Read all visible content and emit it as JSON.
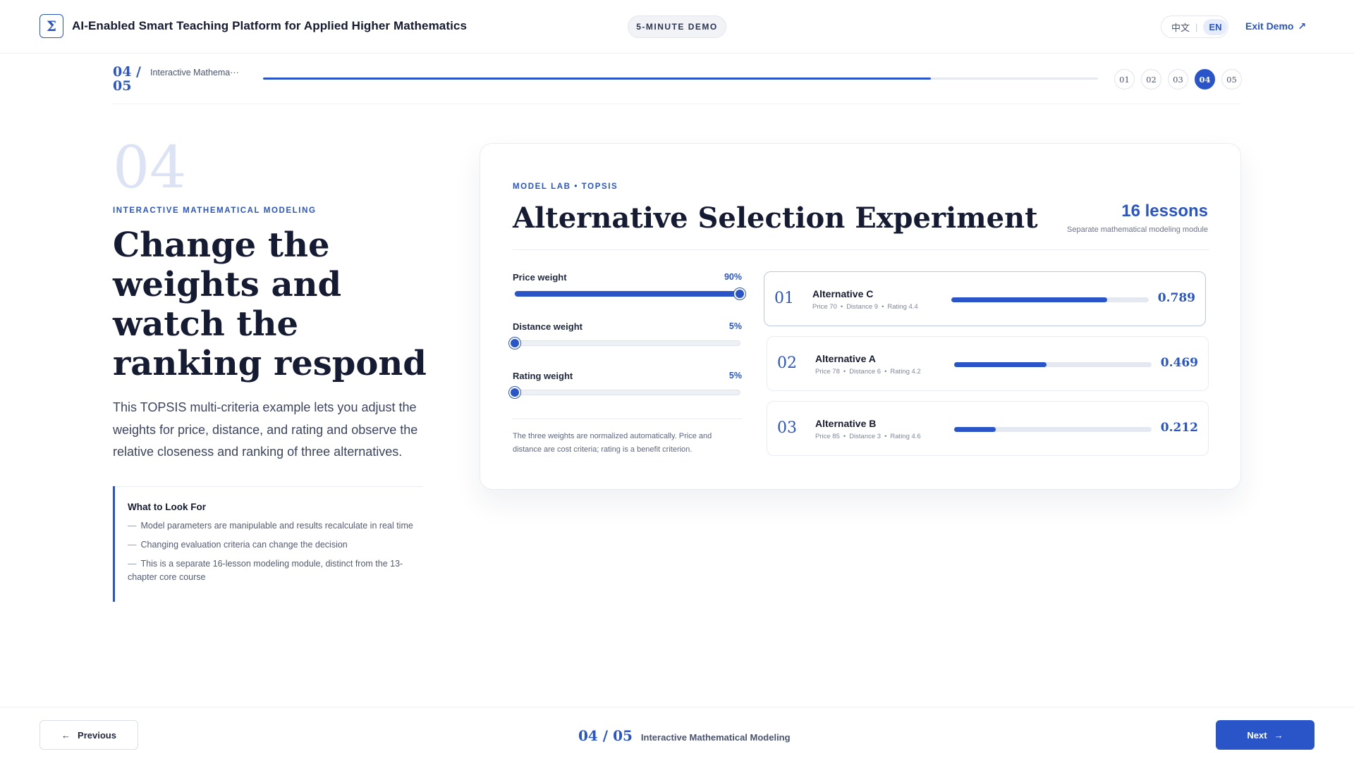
{
  "header": {
    "logo_glyph": "Σ",
    "app_title": "AI-Enabled Smart Teaching Platform for Applied Higher Mathematics",
    "demo_badge": "5-MINUTE DEMO",
    "lang_zh": "中文",
    "lang_sep": "|",
    "lang_en": "EN",
    "exit_label": "Exit Demo",
    "exit_arrow": "↗"
  },
  "progress": {
    "counter_top": "04 /",
    "counter_bottom": "05",
    "label": "Interactive Mathema···",
    "fraction": 0.8,
    "steps": [
      "01",
      "02",
      "03",
      "04",
      "05"
    ],
    "active_index": 3
  },
  "left": {
    "big_number": "04",
    "kicker": "INTERACTIVE MATHEMATICAL MODELING",
    "headline": "Change the weights and watch the ranking respond",
    "description": "This TOPSIS multi-criteria example lets you adjust the weights for price, distance, and rating and observe the relative closeness and ranking of three alternatives.",
    "look_title": "What to Look For",
    "look_items": [
      "Model parameters are manipulable and results recalculate in real time",
      "Changing evaluation criteria can change the decision",
      "This is a separate 16-lesson modeling module, distinct from the 13-chapter core course"
    ],
    "dash": "—"
  },
  "card": {
    "kicker": "MODEL LAB  •  TOPSIS",
    "title": "Alternative Selection Experiment",
    "lessons": "16 lessons",
    "lessons_sub": "Separate mathematical modeling module",
    "sliders": [
      {
        "label": "Price weight",
        "value_text": "90%",
        "value": 1.0
      },
      {
        "label": "Distance weight",
        "value_text": "5%",
        "value": 0.0
      },
      {
        "label": "Rating weight",
        "value_text": "5%",
        "value": 0.0
      }
    ],
    "note": "The three weights are normalized automatically. Price and distance are cost criteria; rating is a benefit criterion.",
    "alternatives": [
      {
        "rank": "01",
        "name": "Alternative C",
        "price": "Price 70",
        "distance": "Distance 9",
        "rating": "Rating 4.4",
        "score_text": "0.789",
        "score": 0.789
      },
      {
        "rank": "02",
        "name": "Alternative A",
        "price": "Price 78",
        "distance": "Distance 6",
        "rating": "Rating 4.2",
        "score_text": "0.469",
        "score": 0.469
      },
      {
        "rank": "03",
        "name": "Alternative B",
        "price": "Price 85",
        "distance": "Distance 3",
        "rating": "Rating 4.6",
        "score_text": "0.212",
        "score": 0.212
      }
    ],
    "meta_dot": "•"
  },
  "footer": {
    "prev_arrow": "←",
    "prev_label": "Previous",
    "step": "04 / 05",
    "label": "Interactive Mathematical Modeling",
    "next_label": "Next",
    "next_arrow": "→"
  },
  "colors": {
    "accent": "#2a55c9",
    "text_dark": "#141b33",
    "muted": "#4a5370"
  }
}
